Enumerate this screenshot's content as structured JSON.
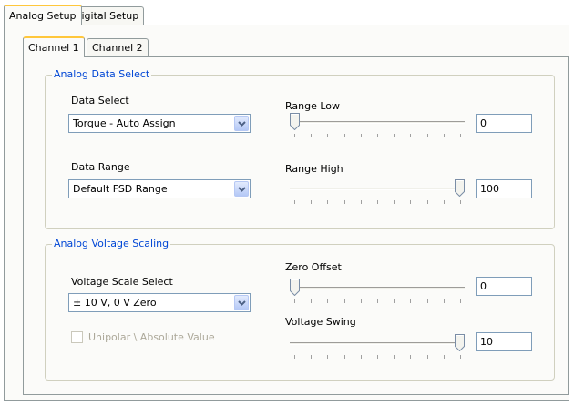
{
  "outer_tabs": [
    "Analog Setup",
    "Digital Setup"
  ],
  "inner_tabs": [
    "Channel 1",
    "Channel 2"
  ],
  "analog_data_select": {
    "title": "Analog Data Select",
    "data_select_label": "Data Select",
    "data_select_value": "Torque - Auto Assign",
    "data_range_label": "Data Range",
    "data_range_value": "Default FSD Range",
    "range_low_label": "Range Low",
    "range_low_value": "0",
    "range_low_position": 0,
    "range_high_label": "Range High",
    "range_high_value": "100",
    "range_high_position": 1
  },
  "analog_voltage_scaling": {
    "title": "Analog Voltage Scaling",
    "voltage_scale_label": "Voltage Scale Select",
    "voltage_scale_value": "± 10 V, 0 V Zero",
    "unipolar_label": "Unipolar \\ Absolute Value",
    "unipolar_checked": false,
    "zero_offset_label": "Zero Offset",
    "zero_offset_value": "0",
    "zero_offset_position": 0,
    "voltage_swing_label": "Voltage Swing",
    "voltage_swing_value": "10",
    "voltage_swing_position": 1
  },
  "colors": {
    "group_title": "#0046d5",
    "active_tab_accent": "#ffc73c",
    "panel_bg": "#fbfbf9"
  }
}
